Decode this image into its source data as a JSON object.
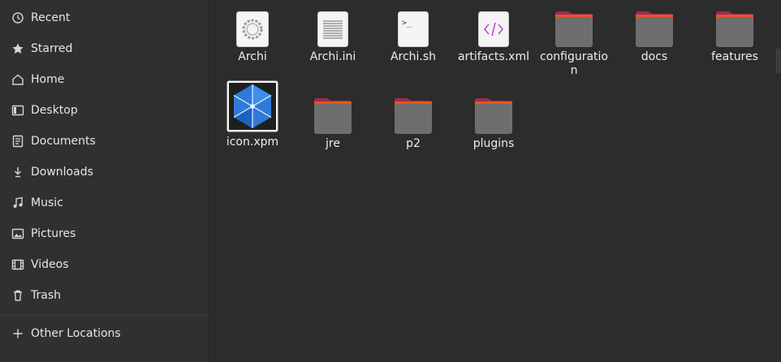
{
  "sidebar": {
    "items": [
      {
        "label": "Recent",
        "icon": "clock-icon"
      },
      {
        "label": "Starred",
        "icon": "star-icon"
      },
      {
        "label": "Home",
        "icon": "home-icon"
      },
      {
        "label": "Desktop",
        "icon": "desktop-icon"
      },
      {
        "label": "Documents",
        "icon": "documents-icon"
      },
      {
        "label": "Downloads",
        "icon": "download-icon"
      },
      {
        "label": "Music",
        "icon": "music-icon"
      },
      {
        "label": "Pictures",
        "icon": "pictures-icon"
      },
      {
        "label": "Videos",
        "icon": "videos-icon"
      },
      {
        "label": "Trash",
        "icon": "trash-icon"
      }
    ],
    "other_locations": {
      "label": "Other Locations",
      "icon": "plus-icon"
    }
  },
  "files": [
    {
      "name": "Archi",
      "type": "executable"
    },
    {
      "name": "Archi.ini",
      "type": "text"
    },
    {
      "name": "Archi.sh",
      "type": "script"
    },
    {
      "name": "artifacts.xml",
      "type": "xml"
    },
    {
      "name": "configuration",
      "type": "folder"
    },
    {
      "name": "docs",
      "type": "folder"
    },
    {
      "name": "features",
      "type": "folder"
    },
    {
      "name": "icon.xpm",
      "type": "image"
    },
    {
      "name": "jre",
      "type": "folder"
    },
    {
      "name": "p2",
      "type": "folder"
    },
    {
      "name": "plugins",
      "type": "folder"
    }
  ],
  "colors": {
    "sidebar_bg": "#303030",
    "main_bg": "#2c2c2c",
    "folder_tab": "#9b2c4f",
    "folder_body": "#6e6e6e",
    "accent_orange": "#e95420"
  }
}
